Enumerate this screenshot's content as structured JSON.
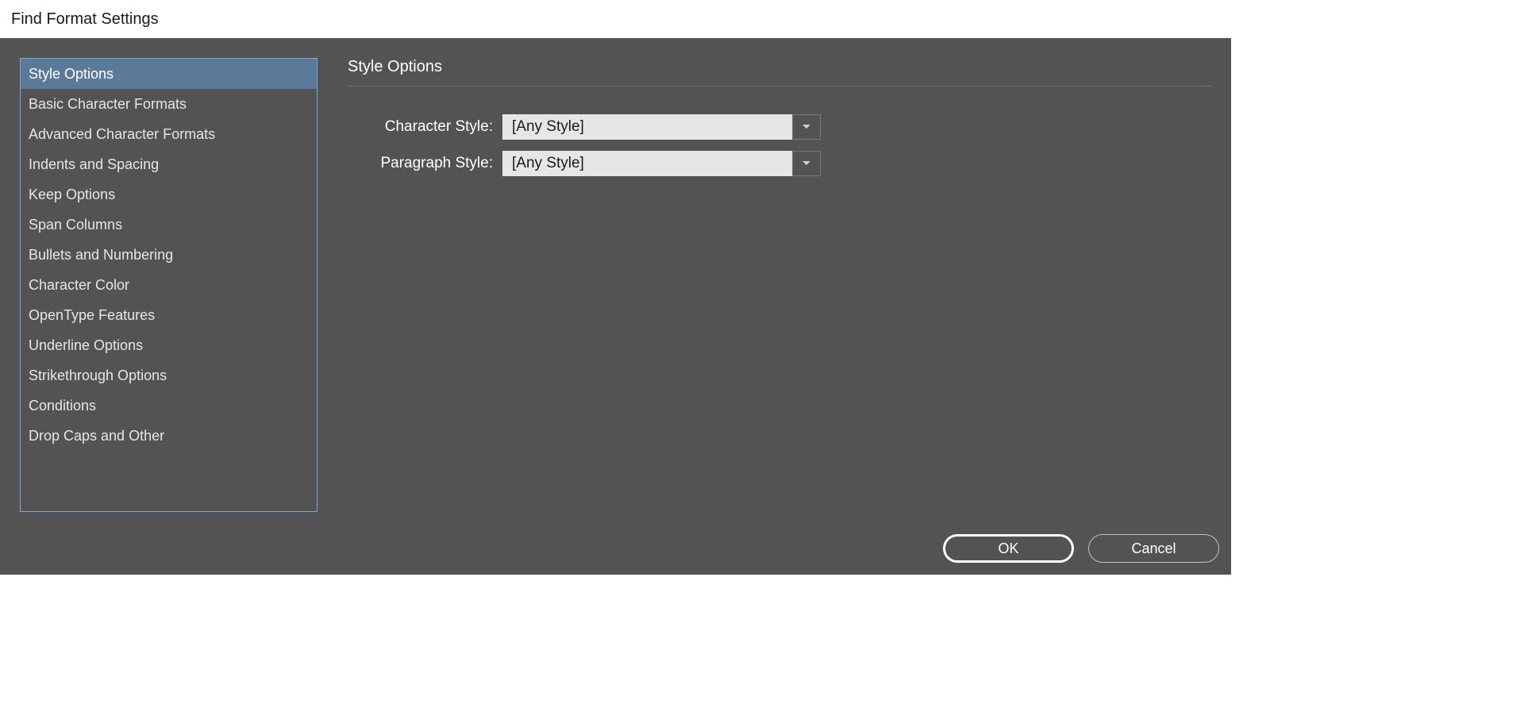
{
  "window": {
    "title": "Find Format Settings"
  },
  "sidebar": {
    "items": [
      "Style Options",
      "Basic Character Formats",
      "Advanced Character Formats",
      "Indents and Spacing",
      "Keep Options",
      "Span Columns",
      "Bullets and Numbering",
      "Character Color",
      "OpenType Features",
      "Underline Options",
      "Strikethrough Options",
      "Conditions",
      "Drop Caps and Other"
    ],
    "selected_index": 0
  },
  "main": {
    "heading": "Style Options",
    "fields": {
      "character_style": {
        "label": "Character Style:",
        "value": "[Any Style]"
      },
      "paragraph_style": {
        "label": "Paragraph Style:",
        "value": "[Any Style]"
      }
    }
  },
  "buttons": {
    "ok": "OK",
    "cancel": "Cancel"
  }
}
